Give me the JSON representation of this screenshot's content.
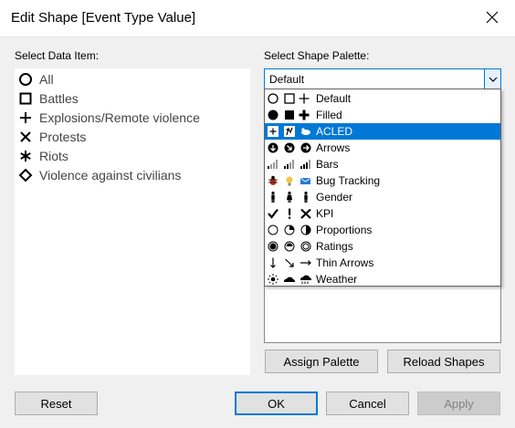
{
  "window": {
    "title": "Edit Shape [Event Type Value]"
  },
  "left": {
    "label": "Select Data Item:",
    "items": [
      {
        "label": "All",
        "icon": "circle-outline-icon"
      },
      {
        "label": "Battles",
        "icon": "square-outline-icon"
      },
      {
        "label": "Explosions/Remote violence",
        "icon": "plus-icon"
      },
      {
        "label": "Protests",
        "icon": "x-icon"
      },
      {
        "label": "Riots",
        "icon": "asterisk-icon"
      },
      {
        "label": "Violence against civilians",
        "icon": "diamond-outline-icon"
      }
    ]
  },
  "right": {
    "label": "Select Shape Palette:",
    "combo_value": "Default",
    "palettes": [
      {
        "label": "Default",
        "selected": false
      },
      {
        "label": "Filled",
        "selected": false
      },
      {
        "label": "ACLED",
        "selected": true
      },
      {
        "label": "Arrows",
        "selected": false
      },
      {
        "label": "Bars",
        "selected": false
      },
      {
        "label": "Bug Tracking",
        "selected": false
      },
      {
        "label": "Gender",
        "selected": false
      },
      {
        "label": "KPI",
        "selected": false
      },
      {
        "label": "Proportions",
        "selected": false
      },
      {
        "label": "Ratings",
        "selected": false
      },
      {
        "label": "Thin Arrows",
        "selected": false
      },
      {
        "label": "Weather",
        "selected": false
      }
    ],
    "assign_label": "Assign Palette",
    "reload_label": "Reload Shapes"
  },
  "footer": {
    "reset_label": "Reset",
    "ok_label": "OK",
    "cancel_label": "Cancel",
    "apply_label": "Apply"
  },
  "colors": {
    "accent": "#0078d7",
    "background": "#f0f0f0",
    "bug_red": "#c0392b",
    "bug_yellow": "#f5c542",
    "bug_blue": "#2a7ad2"
  }
}
